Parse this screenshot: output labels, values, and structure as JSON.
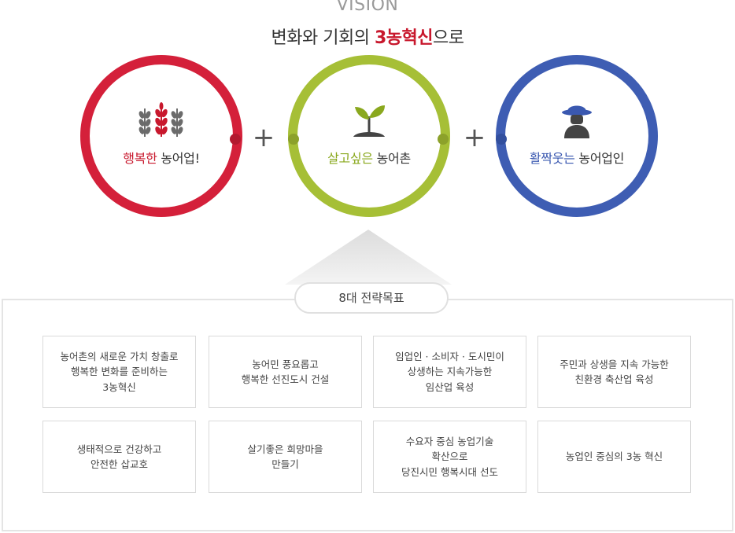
{
  "header": {
    "vision_label": "VISION",
    "title_prefix": "변화와 기회의 ",
    "title_highlight": "3농혁신",
    "title_suffix": "으로"
  },
  "circles": [
    {
      "highlight": "행복한",
      "rest": " 농어업!",
      "icon": "wheat-icon",
      "color": "#d4203a"
    },
    {
      "highlight": "살고싶은",
      "rest": " 농어촌",
      "icon": "sprout-icon",
      "color": "#a6bf36"
    },
    {
      "highlight": "활짝웃는",
      "rest": " 농어업인",
      "icon": "farmer-icon",
      "color": "#3e5db3"
    }
  ],
  "operators": [
    "+",
    "+"
  ],
  "strategy": {
    "tag": "8대 전략목표",
    "goals": [
      "농어촌의 새로운 가치 창출로\n행복한 변화를 준비하는\n3농혁신",
      "농어민 풍요롭고\n행복한 선진도시 건설",
      "임업인 · 소비자 · 도시민이\n상생하는 지속가능한\n임산업 육성",
      "주민과 상생을 지속 가능한\n친환경 축산업 육성",
      "생태적으로 건강하고\n안전한 삽교호",
      "살기좋은 희망마을\n만들기",
      "수요자 중심 농업기술\n확산으로\n당진시민 행복시대 선도",
      "농업인 중심의 3농 혁신"
    ]
  }
}
